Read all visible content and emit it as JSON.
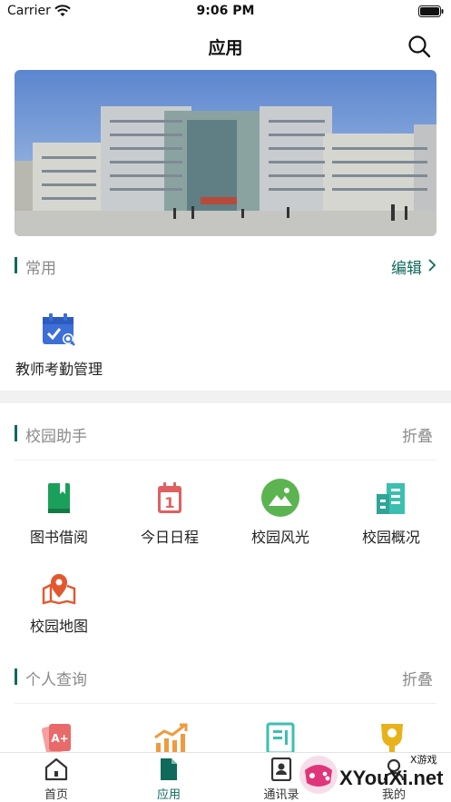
{
  "status_bar": {
    "carrier": "Carrier",
    "time": "9:06 PM"
  },
  "nav": {
    "title": "应用"
  },
  "common": {
    "title": "常用",
    "action": "编辑",
    "items": [
      {
        "label": "教师考勤管理",
        "icon": "attendance-calendar-icon"
      }
    ]
  },
  "campus": {
    "title": "校园助手",
    "action": "折叠",
    "items": [
      {
        "label": "图书借阅",
        "icon": "book-icon"
      },
      {
        "label": "今日日程",
        "icon": "calendar-icon",
        "icon_text": "1"
      },
      {
        "label": "校园风光",
        "icon": "landscape-icon"
      },
      {
        "label": "校园概况",
        "icon": "building-icon"
      },
      {
        "label": "校园地图",
        "icon": "map-pin-icon"
      }
    ]
  },
  "personal": {
    "title": "个人查询",
    "action": "折叠",
    "items": [
      {
        "icon": "grade-card-icon",
        "icon_text": "A+"
      },
      {
        "icon": "chart-icon"
      },
      {
        "icon": "document-icon"
      },
      {
        "icon": "trophy-icon"
      }
    ]
  },
  "tabs": [
    {
      "label": "首页",
      "icon": "home-icon",
      "active": false
    },
    {
      "label": "应用",
      "icon": "app-doc-icon",
      "active": true
    },
    {
      "label": "通讯录",
      "icon": "contacts-icon",
      "active": false
    },
    {
      "label": "我的",
      "icon": "profile-icon",
      "active": false
    }
  ],
  "watermark": {
    "text": "XYouXi.net",
    "small": "X游戏"
  },
  "colors": {
    "accent": "#0f6a5c",
    "book": "#1aa05a",
    "calendar": "#e06060",
    "landscape": "#5bb450",
    "building": "#3bbfb0",
    "map": "#e4572e",
    "attendance": "#3d6fd6"
  }
}
